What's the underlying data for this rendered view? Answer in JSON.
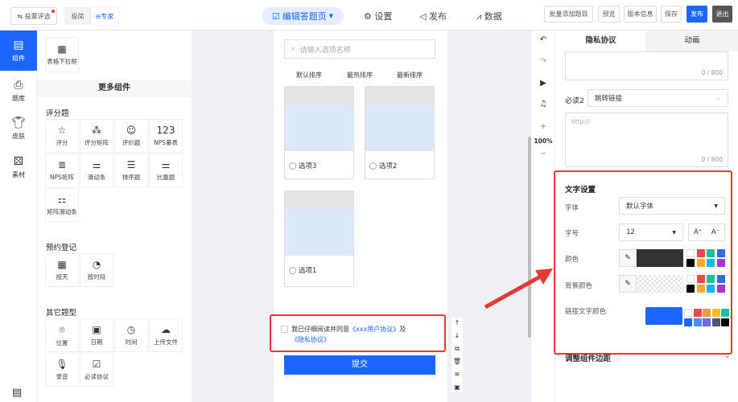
{
  "topbar": {
    "mode_button": "投票评选",
    "simple": "极简",
    "expert": "专家",
    "steps": [
      "编辑答题页",
      "设置",
      "发布",
      "数据"
    ],
    "actions": [
      "批量添加题目",
      "预览",
      "版本信息",
      "保存"
    ],
    "publish": "发布",
    "exit": "退出"
  },
  "rail": [
    {
      "label": "组件",
      "icon": "component-icon"
    },
    {
      "label": "题库",
      "icon": "library-icon"
    },
    {
      "label": "皮肤",
      "icon": "shirt-icon"
    },
    {
      "label": "素材",
      "icon": "shapes-icon"
    }
  ],
  "panel": {
    "top_item": "表格下拉框",
    "more_title": "更多组件",
    "sections": [
      {
        "title": "评分题",
        "items": [
          "评分",
          "评分矩阵",
          "评价题",
          "NPS量表",
          "NPS矩阵",
          "滑动条",
          "排序题",
          "比重题",
          "矩阵滑动条"
        ]
      },
      {
        "title": "预约登记",
        "items": [
          "按天",
          "按时段"
        ]
      },
      {
        "title": "其它题型",
        "items": [
          "位置",
          "日期",
          "时间",
          "上传文件",
          "录音",
          "必读协议"
        ]
      }
    ]
  },
  "canvas": {
    "search_placeholder": "请输入选项名称",
    "sorts": [
      "默认排序",
      "最热排序",
      "最新排序"
    ],
    "options": [
      "选项3",
      "选项2",
      "选项1"
    ],
    "agreement": {
      "text": "我已仔细阅读并同意",
      "link1": "《xxx用户协议》",
      "and": "及",
      "link2": "《隐私协议》"
    },
    "submit": "提交"
  },
  "toolbar": {
    "zoom": "100%"
  },
  "right": {
    "tabs": [
      "隐私协议",
      "动画"
    ],
    "count1": "0 / 800",
    "required2_label": "必读2",
    "required2_value": "跳转链接",
    "url_placeholder": "http://",
    "count2": "0 / 800",
    "text_settings": {
      "title": "文字设置",
      "font_label": "字体",
      "font_value": "默认字体",
      "size_label": "字号",
      "size_value": "12",
      "inc": "A⁺",
      "dec": "A⁻",
      "color_label": "颜色",
      "color_value": "#333333",
      "bg_label": "背景颜色",
      "link_label": "链接文字颜色",
      "link_color": "#1a66ff"
    },
    "margin_title": "调整组件边距"
  },
  "colors": {
    "accent": "#1a66ff",
    "highlight": "#e53935",
    "palette1": [
      "#ffffff",
      "#f04848",
      "#1dbf9f",
      "#2f6bdc",
      "#000000",
      "#f7a835",
      "#14b4ef",
      "#a834d0"
    ],
    "palette2": [
      "#ffffff",
      "#f04848",
      "#e89a4e",
      "#f5bd2c",
      "#1dbf9f",
      "#1a66ff",
      "#4b8ff0",
      "#6b6be0",
      "#4e5670",
      "#000000"
    ]
  }
}
